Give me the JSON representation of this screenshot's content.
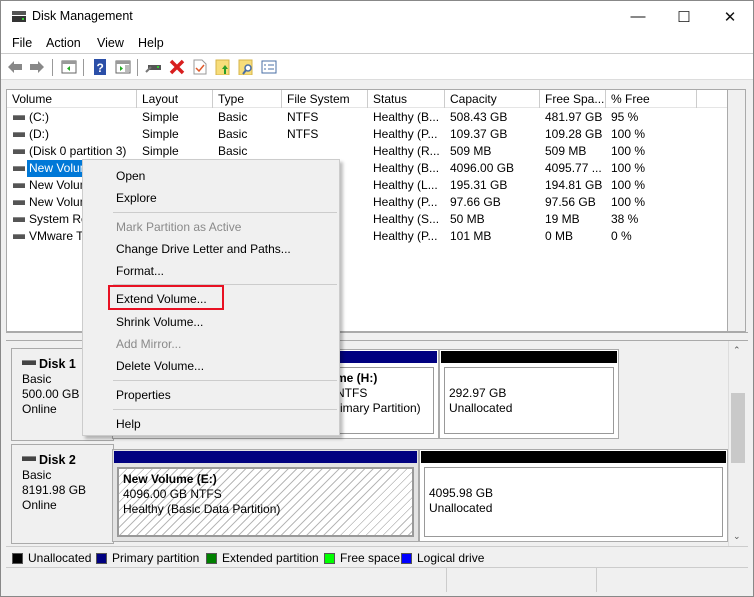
{
  "window": {
    "title": "Disk Management",
    "controls": {
      "minimize": "—",
      "maximize": "☐",
      "close": "✕"
    }
  },
  "menubar": [
    "File",
    "Action",
    "View",
    "Help"
  ],
  "toolbar": {
    "icons": [
      "back-icon",
      "forward-icon",
      "show-hide-console-tree-icon",
      "help-icon",
      "show-hide-action-pane-icon",
      "connect-disk-icon",
      "delete-icon",
      "check-icon",
      "folder-up-icon",
      "folder-search-icon",
      "properties-list-icon"
    ]
  },
  "volume_list": {
    "columns": [
      "Volume",
      "Layout",
      "Type",
      "File System",
      "Status",
      "Capacity",
      "Free Spa...",
      "% Free"
    ],
    "rows": [
      {
        "volume": "(C:)",
        "layout": "Simple",
        "type": "Basic",
        "fs": "NTFS",
        "status": "Healthy (B...",
        "capacity": "508.43 GB",
        "free": "481.97 GB",
        "pct": "95 %"
      },
      {
        "volume": "(D:)",
        "layout": "Simple",
        "type": "Basic",
        "fs": "NTFS",
        "status": "Healthy (P...",
        "capacity": "109.37 GB",
        "free": "109.28 GB",
        "pct": "100 %"
      },
      {
        "volume": "(Disk 0 partition 3)",
        "layout": "Simple",
        "type": "Basic",
        "fs": "",
        "status": "Healthy (R...",
        "capacity": "509 MB",
        "free": "509 MB",
        "pct": "100 %"
      },
      {
        "volume": "New Volume",
        "layout": "",
        "type": "",
        "fs": "",
        "status": "Healthy (B...",
        "capacity": "4096.00 GB",
        "free": "4095.77 ...",
        "pct": "100 %",
        "selected": true
      },
      {
        "volume": "New Volume",
        "layout": "",
        "type": "",
        "fs": "",
        "status": "Healthy (L...",
        "capacity": "195.31 GB",
        "free": "194.81 GB",
        "pct": "100 %"
      },
      {
        "volume": "New Volume",
        "layout": "",
        "type": "",
        "fs": "",
        "status": "Healthy (P...",
        "capacity": "97.66 GB",
        "free": "97.56 GB",
        "pct": "100 %"
      },
      {
        "volume": "System Re",
        "layout": "",
        "type": "",
        "fs": "",
        "status": "Healthy (S...",
        "capacity": "50 MB",
        "free": "19 MB",
        "pct": "38 %"
      },
      {
        "volume": "VMware T",
        "layout": "",
        "type": "",
        "fs": "",
        "status": "Healthy (P...",
        "capacity": "101 MB",
        "free": "0 MB",
        "pct": "0 %"
      }
    ]
  },
  "context_menu": {
    "items": [
      {
        "label": "Open",
        "disabled": false
      },
      {
        "label": "Explore",
        "disabled": false
      },
      {
        "label": "Mark Partition as Active",
        "disabled": true
      },
      {
        "label": "Change Drive Letter and Paths...",
        "disabled": false
      },
      {
        "label": "Format...",
        "disabled": false
      },
      {
        "label": "Extend Volume...",
        "disabled": false,
        "highlighted": true
      },
      {
        "label": "Shrink Volume...",
        "disabled": false
      },
      {
        "label": "Add Mirror...",
        "disabled": true
      },
      {
        "label": "Delete Volume...",
        "disabled": false
      },
      {
        "label": "Properties",
        "disabled": false
      },
      {
        "label": "Help",
        "disabled": false
      }
    ]
  },
  "disks": [
    {
      "name": "Disk 1",
      "type": "Basic",
      "size": "500.00 GB",
      "state": "Online",
      "partitions": [
        {
          "title": "me  (H:)",
          "line2": "NTFS",
          "line3": "rimary Partition)",
          "kind": "primary"
        },
        {
          "title": "",
          "line2": "292.97 GB",
          "line3": "Unallocated",
          "kind": "unallocated"
        }
      ]
    },
    {
      "name": "Disk 2",
      "type": "Basic",
      "size": "8191.98 GB",
      "state": "Online",
      "partitions": [
        {
          "title": "New Volume  (E:)",
          "line2": "4096.00 GB NTFS",
          "line3": "Healthy (Basic Data Partition)",
          "kind": "primary"
        },
        {
          "title": "",
          "line2": "4095.98 GB",
          "line3": "Unallocated",
          "kind": "unallocated"
        }
      ]
    }
  ],
  "legend": [
    {
      "label": "Unallocated",
      "color": "#000000"
    },
    {
      "label": "Primary partition",
      "color": "#000080"
    },
    {
      "label": "Extended partition",
      "color": "#008000"
    },
    {
      "label": "Free space",
      "color": "#00ff00"
    },
    {
      "label": "Logical drive",
      "color": "#0000ff"
    }
  ],
  "colors": {
    "selection": "#0078d7",
    "highlight_box": "#e81123",
    "primary_bar": "#000080",
    "unallocated_bar": "#000000"
  }
}
